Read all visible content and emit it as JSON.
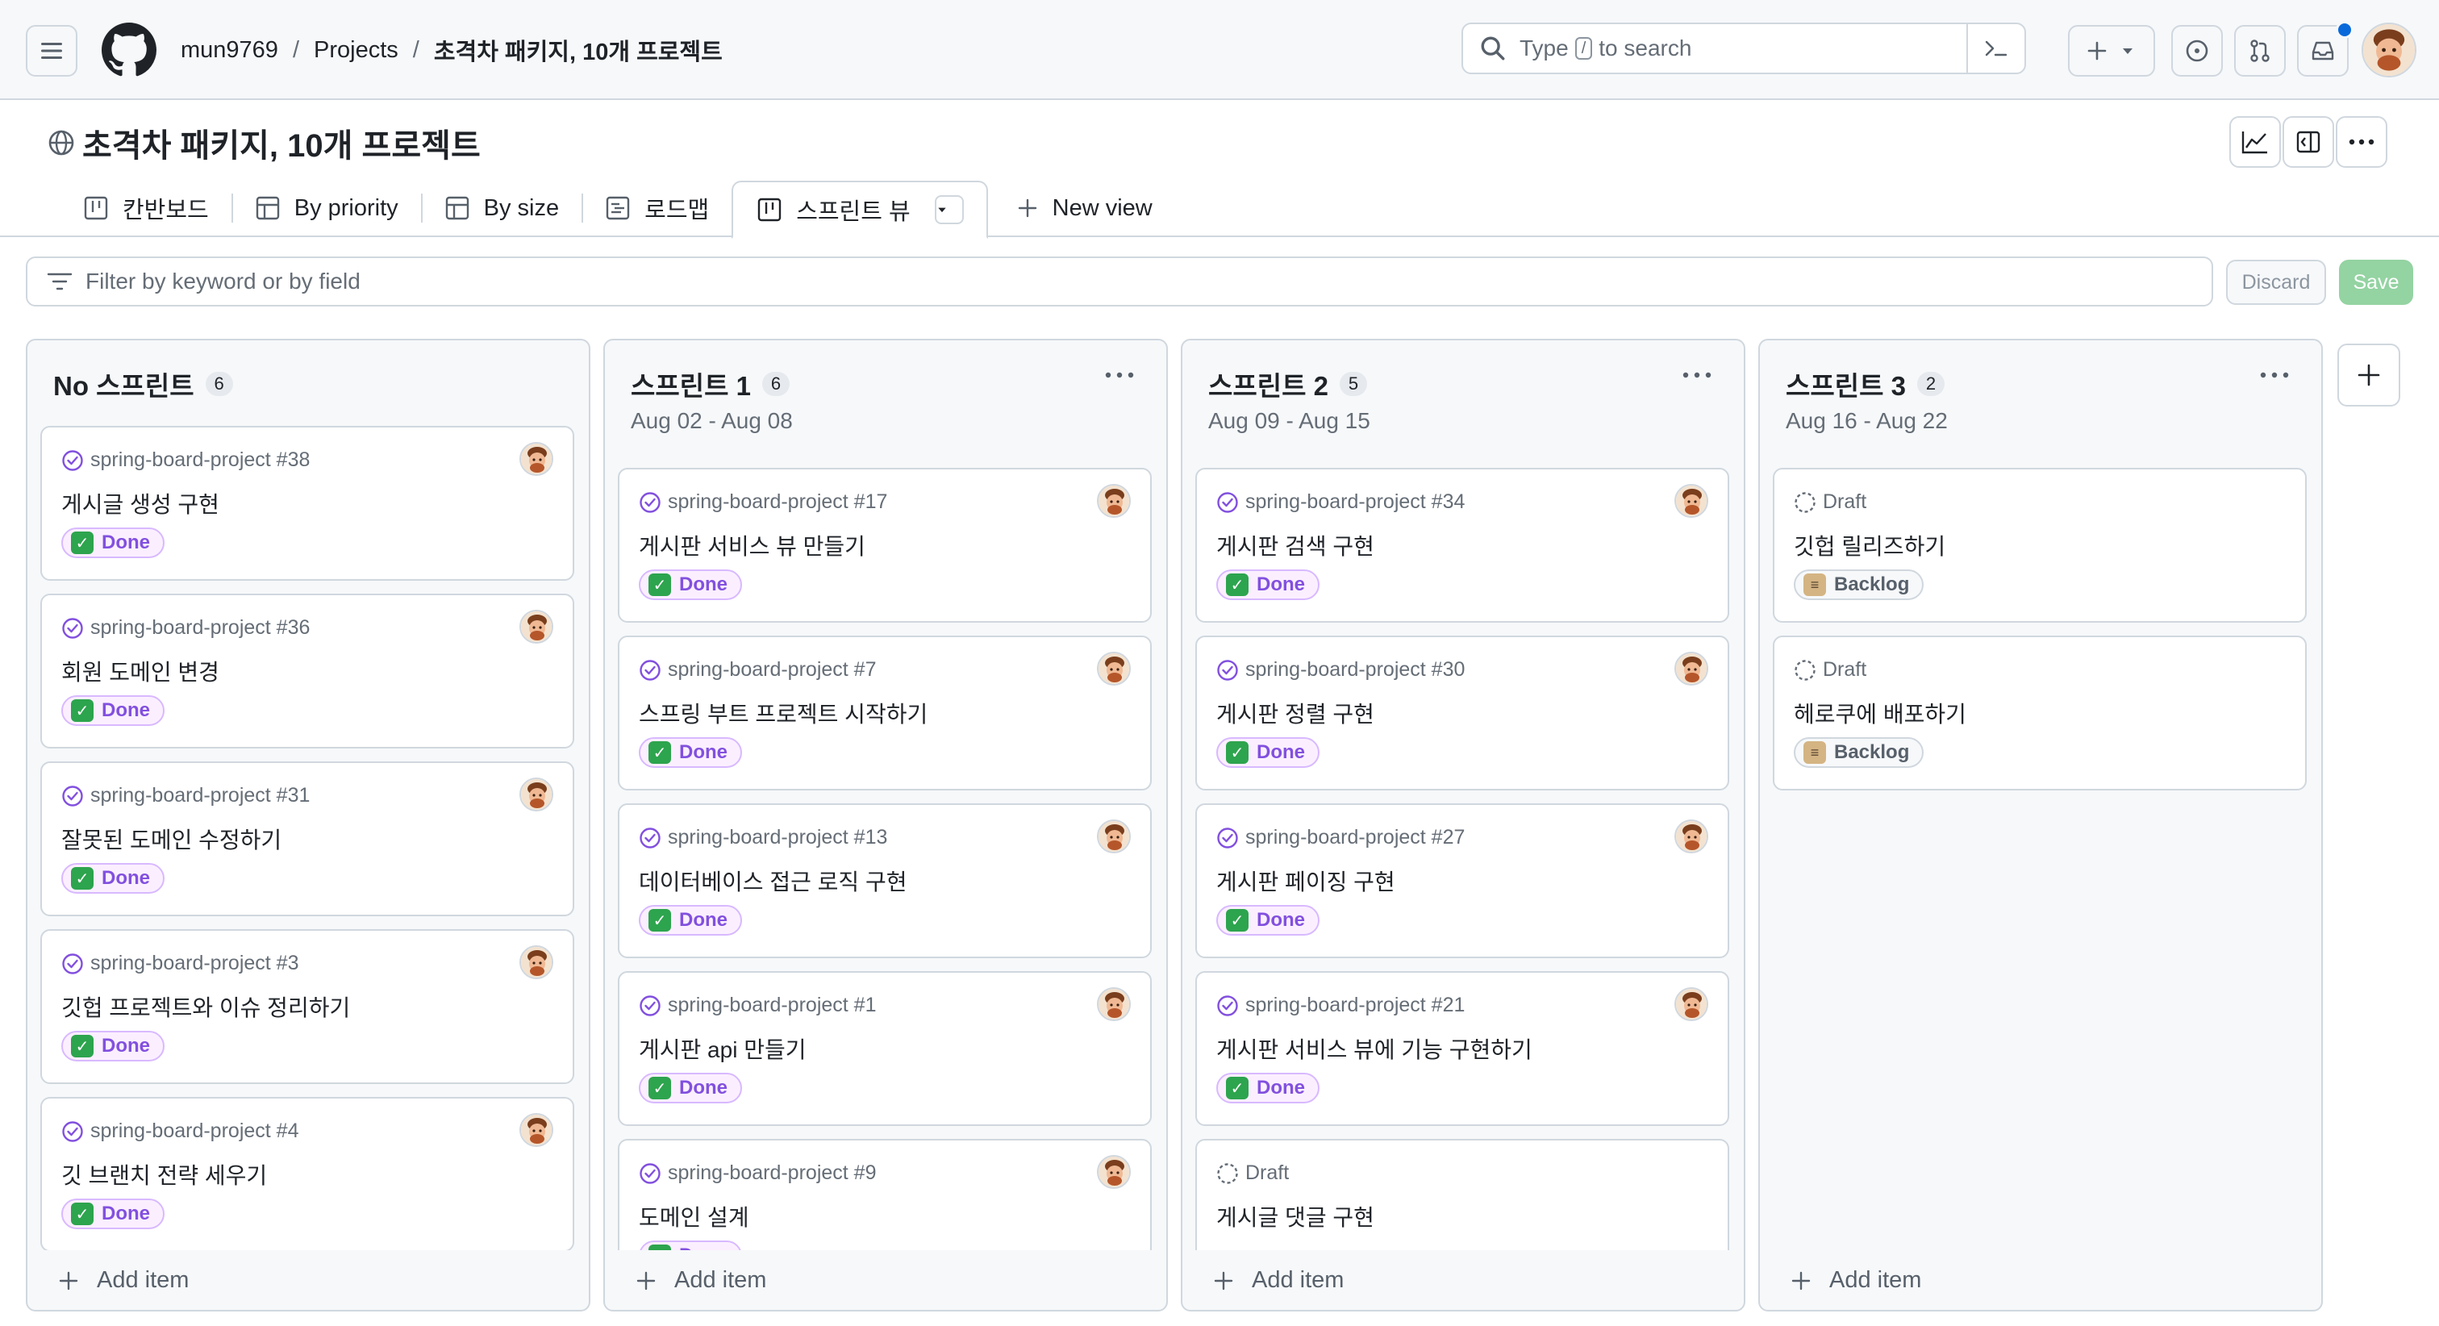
{
  "header": {
    "owner": "mun9769",
    "projects_link": "Projects",
    "project_crumb": "초격차 패키지, 10개 프로젝트",
    "search_prefix": "Type",
    "search_key": "/",
    "search_suffix": "to search"
  },
  "project": {
    "title": "초격차 패키지, 10개 프로젝트"
  },
  "tabs": [
    {
      "label": "칸반보드",
      "icon": "board-icon"
    },
    {
      "label": "By priority",
      "icon": "table-icon"
    },
    {
      "label": "By size",
      "icon": "table-icon"
    },
    {
      "label": "로드맵",
      "icon": "roadmap-icon"
    },
    {
      "label": "스프린트 뷰",
      "icon": "board-icon",
      "active": true
    }
  ],
  "new_view_label": "New view",
  "filter": {
    "placeholder": "Filter by keyword or by field",
    "discard_label": "Discard",
    "save_label": "Save"
  },
  "add_item_label": "Add item",
  "columns": [
    {
      "title": "No 스프린트",
      "count": "6",
      "dates": "",
      "cards": [
        {
          "type": "issue",
          "ref": "spring-board-project #38",
          "title": "게시글 생성 구현",
          "status": "Done"
        },
        {
          "type": "issue",
          "ref": "spring-board-project #36",
          "title": "회원 도메인 변경",
          "status": "Done"
        },
        {
          "type": "issue",
          "ref": "spring-board-project #31",
          "title": "잘못된 도메인 수정하기",
          "status": "Done"
        },
        {
          "type": "issue",
          "ref": "spring-board-project #3",
          "title": "깃헙 프로젝트와 이슈 정리하기",
          "status": "Done"
        },
        {
          "type": "issue",
          "ref": "spring-board-project #4",
          "title": "깃 브랜치 전략 세우기",
          "status": "Done"
        }
      ]
    },
    {
      "title": "스프린트 1",
      "count": "6",
      "dates": "Aug 02 - Aug 08",
      "cards": [
        {
          "type": "issue",
          "ref": "spring-board-project #17",
          "title": "게시판 서비스 뷰 만들기",
          "status": "Done"
        },
        {
          "type": "issue",
          "ref": "spring-board-project #7",
          "title": "스프링 부트 프로젝트 시작하기",
          "status": "Done"
        },
        {
          "type": "issue",
          "ref": "spring-board-project #13",
          "title": "데이터베이스 접근 로직 구현",
          "status": "Done"
        },
        {
          "type": "issue",
          "ref": "spring-board-project #1",
          "title": "게시판 api 만들기",
          "status": "Done"
        },
        {
          "type": "issue",
          "ref": "spring-board-project #9",
          "title": "도메인 설계",
          "status": "Done"
        }
      ]
    },
    {
      "title": "스프린트 2",
      "count": "5",
      "dates": "Aug 09 - Aug 15",
      "cards": [
        {
          "type": "issue",
          "ref": "spring-board-project #34",
          "title": "게시판 검색 구현",
          "status": "Done"
        },
        {
          "type": "issue",
          "ref": "spring-board-project #30",
          "title": "게시판 정렬 구현",
          "status": "Done"
        },
        {
          "type": "issue",
          "ref": "spring-board-project #27",
          "title": "게시판 페이징 구현",
          "status": "Done"
        },
        {
          "type": "issue",
          "ref": "spring-board-project #21",
          "title": "게시판 서비스 뷰에 기능 구현하기",
          "status": "Done"
        },
        {
          "type": "draft",
          "ref": "Draft",
          "title": "게시글 댓글 구현",
          "status": ""
        }
      ]
    },
    {
      "title": "스프린트 3",
      "count": "2",
      "dates": "Aug 16 - Aug 22",
      "cards": [
        {
          "type": "draft",
          "ref": "Draft",
          "title": "깃헙 릴리즈하기",
          "status": "Backlog"
        },
        {
          "type": "draft",
          "ref": "Draft",
          "title": "헤로쿠에 배포하기",
          "status": "Backlog"
        }
      ]
    }
  ],
  "colors": {
    "done_text": "#8250df",
    "done_bg": "#fbefff",
    "done_check": "#2da44e",
    "issue_closed": "#8250df",
    "save_button": "#94d3a2",
    "notification_dot": "#0969da"
  }
}
